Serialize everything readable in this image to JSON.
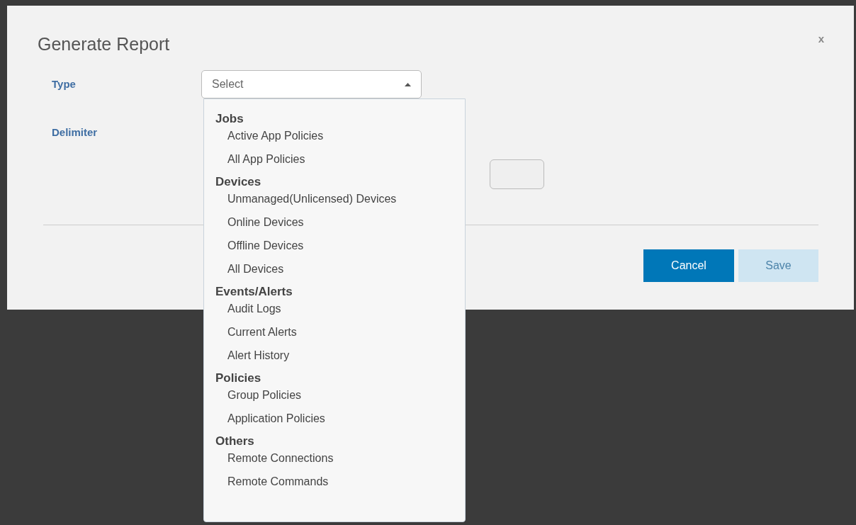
{
  "dialog": {
    "title": "Generate Report",
    "close": "x"
  },
  "fields": [
    {
      "label": "Type",
      "kind": "select",
      "placeholder": "Select",
      "expanded": true
    },
    {
      "label": "Delimiter",
      "kind": "text"
    }
  ],
  "dropdown": {
    "groups": [
      {
        "label": "Jobs",
        "items": [
          "Active App Policies",
          "All App Policies"
        ]
      },
      {
        "label": "Devices",
        "items": [
          "Unmanaged(Unlicensed) Devices",
          "Online Devices",
          "Offline Devices",
          "All Devices"
        ]
      },
      {
        "label": "Events/Alerts",
        "items": [
          "Audit Logs",
          "Current Alerts",
          "Alert History"
        ]
      },
      {
        "label": "Policies",
        "items": [
          "Group Policies",
          "Application Policies"
        ]
      },
      {
        "label": "Others",
        "items": [
          "Remote Connections",
          "Remote Commands"
        ]
      }
    ]
  },
  "buttons": [
    {
      "label": "Cancel",
      "disabled": false
    },
    {
      "label": "Save",
      "disabled": true
    }
  ]
}
